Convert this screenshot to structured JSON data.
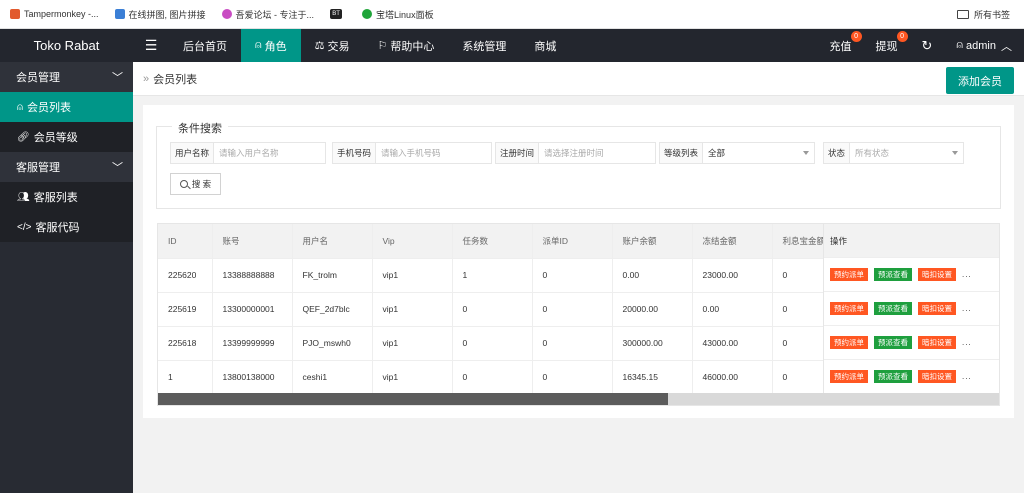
{
  "bookmarks": {
    "items": [
      {
        "label": "Tampermonkey -...",
        "color": "#e25a2e"
      },
      {
        "label": "在线拼图, 图片拼接",
        "color": "#3b7fd6"
      },
      {
        "label": "吾爱论坛 - 专注于...",
        "color": "#c94cc3"
      },
      {
        "label": "宝塔Linux面板",
        "color": "#20a53a"
      }
    ],
    "bt_label": "BT",
    "all_bookmarks": "所有书签"
  },
  "header": {
    "brand": "Toko Rabat",
    "nav": [
      {
        "label": "后台首页",
        "icon": ""
      },
      {
        "label": "角色",
        "icon": "user-icon",
        "active": true
      },
      {
        "label": "交易",
        "icon": "scale-icon"
      },
      {
        "label": "帮助中心",
        "icon": "flag-icon"
      },
      {
        "label": "系统管理",
        "icon": ""
      },
      {
        "label": "商城",
        "icon": ""
      }
    ],
    "recharge": "充值",
    "recharge_badge": "0",
    "withdraw": "提现",
    "withdraw_badge": "0",
    "user": "admin"
  },
  "sidebar": {
    "group1": "会员管理",
    "item1": "会员列表",
    "item2": "会员等级",
    "group2": "客服管理",
    "item3": "客服列表",
    "item4": "客服代码"
  },
  "main": {
    "breadcrumb": "会员列表",
    "add_button": "添加会员"
  },
  "search": {
    "legend": "条件搜索",
    "username_label": "用户名称",
    "username_placeholder": "请输入用户名称",
    "phone_label": "手机号码",
    "phone_placeholder": "请输入手机号码",
    "regtime_label": "注册时间",
    "regtime_placeholder": "请选择注册时间",
    "level_label": "等级列表",
    "level_value": "全部",
    "status_label": "状态",
    "status_placeholder": "所有状态",
    "button": "搜 索"
  },
  "table": {
    "columns": [
      "ID",
      "账号",
      "用户名",
      "Vip",
      "任务数",
      "派单ID",
      "账户余额",
      "冻结金额",
      "利息宝金额"
    ],
    "ops_header": "操作",
    "rows": [
      [
        "225620",
        "13388888888",
        "FK_trolm",
        "vip1",
        "1",
        "0",
        "0.00",
        "23000.00",
        "0"
      ],
      [
        "225619",
        "13300000001",
        "QEF_2d7blc",
        "vip1",
        "0",
        "0",
        "20000.00",
        "0.00",
        "0"
      ],
      [
        "225618",
        "13399999999",
        "PJO_mswh0",
        "vip1",
        "0",
        "0",
        "300000.00",
        "43000.00",
        "0"
      ],
      [
        "1",
        "13800138000",
        "ceshi1",
        "vip1",
        "0",
        "0",
        "16345.15",
        "46000.00",
        "0"
      ]
    ],
    "ops": {
      "preset": "预约派单",
      "view": "预派查看",
      "deduct": "暗扣设置",
      "more": "..."
    }
  }
}
